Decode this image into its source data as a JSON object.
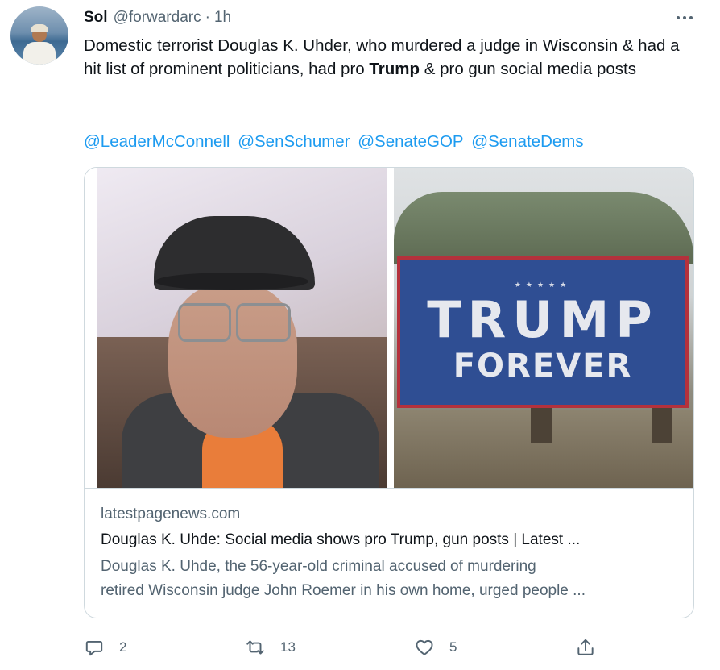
{
  "author": {
    "name": "Sol",
    "handle": "@forwardarc",
    "separator": "·",
    "time": "1h"
  },
  "tweet": {
    "text_before_bold": "Domestic terrorist Douglas K. Uhder, who murdered a judge in Wisconsin & had a hit list of prominent politicians, had pro ",
    "bold": "Trump",
    "text_after_bold": " & pro gun social media posts",
    "mentions": [
      "@LeaderMcConnell",
      "@SenSchumer",
      "@SenateGOP",
      "@SenateDems"
    ]
  },
  "card": {
    "image_left_alt": "photo of man in cap and glasses",
    "sign_text_line1": "TRUMP",
    "sign_text_line2": "FOREVER",
    "domain": "latestpagenews.com",
    "title": "Douglas K. Uhde: Social media shows pro Trump, gun posts | Latest ...",
    "description_line1": "Douglas K. Uhde, the 56-year-old criminal accused of murdering",
    "description_line2": "retired Wisconsin judge John Roemer in his own home, urged people ..."
  },
  "actions": {
    "reply_count": "2",
    "retweet_count": "13",
    "like_count": "5",
    "icons": [
      "reply-icon",
      "retweet-icon",
      "like-icon",
      "share-icon"
    ]
  },
  "colors": {
    "link": "#1d9bf0",
    "secondary_text": "#536471",
    "border": "#cfd9de"
  }
}
